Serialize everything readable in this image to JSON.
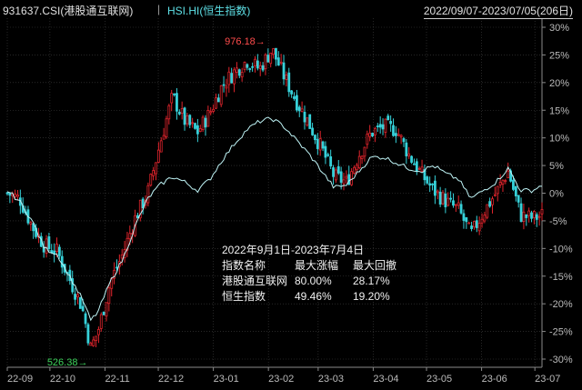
{
  "header": {
    "main_index": "931637.CSI(港股通互联网)",
    "separator": "|",
    "compare_index": "HSI.HI(恒生指数)",
    "date_range": "2022/09/07-2023/07/05(206日)"
  },
  "stats_table": {
    "title": "2022年9月1日-2023年7月4日",
    "headers": [
      "指数名称",
      "最大涨幅",
      "最大回撤"
    ],
    "rows": [
      [
        "港股通互联网",
        "80.00%",
        "28.17%"
      ],
      [
        "恒生指数",
        "49.46%",
        "19.20%"
      ]
    ]
  },
  "colors": {
    "background": "#000000",
    "up_candle": "#e0242c",
    "down_candle": "#36d1d9",
    "hsi_line": "#bff4f6",
    "grid": "#404040",
    "axis_text": "#bbbbbb",
    "high_label": "#ff4c4c",
    "low_label": "#3ed35c"
  },
  "chart_data": {
    "type": "candlestick",
    "y_unit": "%",
    "ylim": [
      -31,
      31
    ],
    "y_ticks": [
      "30%",
      "25%",
      "20%",
      "15%",
      "10%",
      "5%",
      "0%",
      "-5%",
      "-10%",
      "-15%",
      "-20%",
      "-25%",
      "-30%"
    ],
    "x_ticks": [
      "22-09",
      "22-10",
      "22-11",
      "22-12",
      "23-01",
      "23-02",
      "23-03",
      "23-04",
      "23-05",
      "23-06",
      "23-07"
    ],
    "x_period": [
      "2022-09-07",
      "2023-07-05"
    ],
    "annotations": [
      {
        "label": "976.18",
        "arrow": "→",
        "date": "2023-02-01",
        "value": 27.5
      },
      {
        "label": "526.38",
        "arrow": "→",
        "date": "2022-10-24",
        "value": -30.5
      }
    ],
    "series": [
      {
        "name": "931637.CSI(港股通互联网)",
        "kind": "close",
        "points": [
          [
            "2022-09-07",
            0.0
          ],
          [
            "2022-09-14",
            -1.0
          ],
          [
            "2022-09-21",
            -6.0
          ],
          [
            "2022-09-28",
            -9.5
          ],
          [
            "2022-10-05",
            -10.5
          ],
          [
            "2022-10-12",
            -15.5
          ],
          [
            "2022-10-19",
            -20.5
          ],
          [
            "2022-10-24",
            -28.0
          ],
          [
            "2022-10-28",
            -25.0
          ],
          [
            "2022-11-04",
            -16.0
          ],
          [
            "2022-11-11",
            -11.0
          ],
          [
            "2022-11-18",
            -4.5
          ],
          [
            "2022-11-25",
            0.0
          ],
          [
            "2022-12-02",
            9.0
          ],
          [
            "2022-12-09",
            17.5
          ],
          [
            "2022-12-16",
            13.0
          ],
          [
            "2022-12-23",
            11.0
          ],
          [
            "2022-12-30",
            14.5
          ],
          [
            "2023-01-06",
            19.5
          ],
          [
            "2023-01-13",
            22.0
          ],
          [
            "2023-01-20",
            24.0
          ],
          [
            "2023-01-27",
            22.5
          ],
          [
            "2023-02-03",
            26.0
          ],
          [
            "2023-02-10",
            21.0
          ],
          [
            "2023-02-17",
            16.5
          ],
          [
            "2023-02-24",
            12.5
          ],
          [
            "2023-03-03",
            8.0
          ],
          [
            "2023-03-10",
            3.0
          ],
          [
            "2023-03-17",
            2.0
          ],
          [
            "2023-03-24",
            7.0
          ],
          [
            "2023-03-31",
            11.0
          ],
          [
            "2023-04-07",
            12.0
          ],
          [
            "2023-04-14",
            11.5
          ],
          [
            "2023-04-21",
            7.0
          ],
          [
            "2023-04-28",
            3.5
          ],
          [
            "2023-05-05",
            0.5
          ],
          [
            "2023-05-12",
            -1.5
          ],
          [
            "2023-05-19",
            -3.0
          ],
          [
            "2023-05-26",
            -7.5
          ],
          [
            "2023-06-02",
            -3.5
          ],
          [
            "2023-06-09",
            0.0
          ],
          [
            "2023-06-16",
            4.0
          ],
          [
            "2023-06-23",
            -4.0
          ],
          [
            "2023-06-30",
            -4.5
          ],
          [
            "2023-07-05",
            -4.0
          ]
        ]
      },
      {
        "name": "HSI.HI(恒生指数)",
        "kind": "line",
        "points": [
          [
            "2022-09-07",
            0.5
          ],
          [
            "2022-09-14",
            -1.5
          ],
          [
            "2022-09-21",
            -5.0
          ],
          [
            "2022-09-28",
            -10.0
          ],
          [
            "2022-10-05",
            -11.0
          ],
          [
            "2022-10-12",
            -15.0
          ],
          [
            "2022-10-19",
            -19.0
          ],
          [
            "2022-10-24",
            -23.0
          ],
          [
            "2022-10-28",
            -21.5
          ],
          [
            "2022-11-04",
            -16.0
          ],
          [
            "2022-11-11",
            -12.0
          ],
          [
            "2022-11-18",
            -6.0
          ],
          [
            "2022-11-25",
            -1.0
          ],
          [
            "2022-12-02",
            1.5
          ],
          [
            "2022-12-09",
            3.0
          ],
          [
            "2022-12-16",
            2.0
          ],
          [
            "2022-12-23",
            0.5
          ],
          [
            "2022-12-30",
            2.5
          ],
          [
            "2023-01-06",
            6.0
          ],
          [
            "2023-01-13",
            9.0
          ],
          [
            "2023-01-20",
            11.5
          ],
          [
            "2023-01-27",
            13.0
          ],
          [
            "2023-02-03",
            13.5
          ],
          [
            "2023-02-10",
            12.0
          ],
          [
            "2023-02-17",
            9.5
          ],
          [
            "2023-02-24",
            7.0
          ],
          [
            "2023-03-03",
            4.0
          ],
          [
            "2023-03-10",
            1.0
          ],
          [
            "2023-03-17",
            1.5
          ],
          [
            "2023-03-24",
            4.0
          ],
          [
            "2023-03-31",
            6.5
          ],
          [
            "2023-04-07",
            6.5
          ],
          [
            "2023-04-14",
            5.5
          ],
          [
            "2023-04-21",
            4.5
          ],
          [
            "2023-04-28",
            4.0
          ],
          [
            "2023-05-05",
            5.0
          ],
          [
            "2023-05-12",
            3.5
          ],
          [
            "2023-05-19",
            2.5
          ],
          [
            "2023-05-26",
            -1.0
          ],
          [
            "2023-06-02",
            0.5
          ],
          [
            "2023-06-09",
            2.0
          ],
          [
            "2023-06-16",
            4.5
          ],
          [
            "2023-06-23",
            0.5
          ],
          [
            "2023-06-30",
            0.5
          ],
          [
            "2023-07-05",
            1.5
          ]
        ]
      }
    ]
  }
}
